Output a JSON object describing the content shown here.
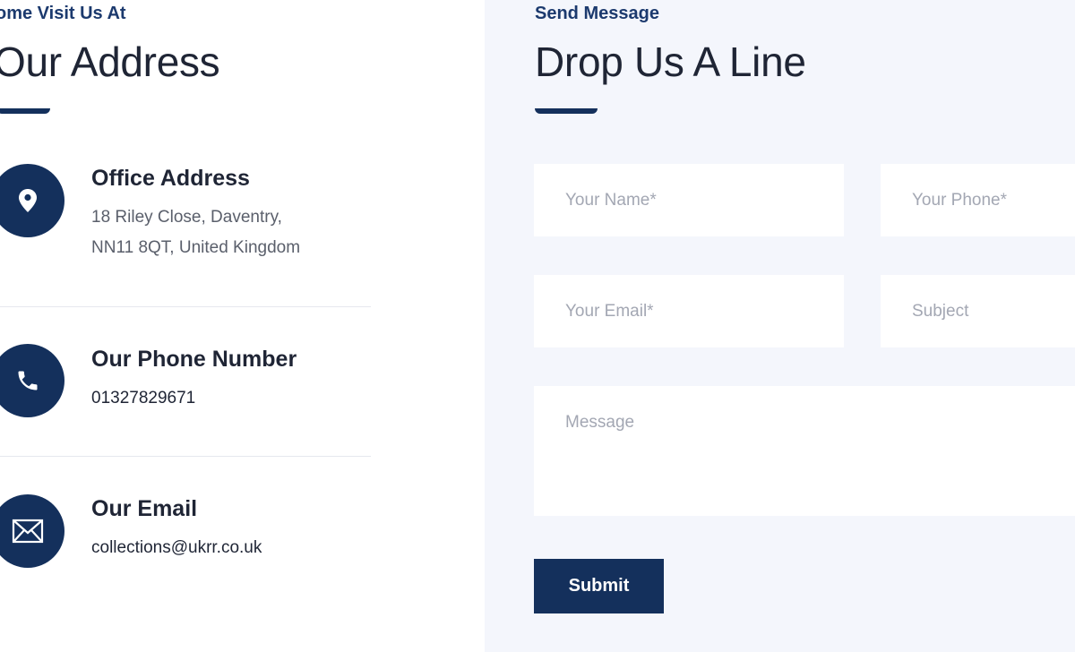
{
  "contact_info": {
    "eyebrow": "ome Visit Us At",
    "title": "Our Address",
    "items": [
      {
        "icon": "map-pin-icon",
        "title": "Office Address",
        "lines": [
          "18 Riley Close, Daventry,",
          "NN11 8QT, United Kingdom"
        ]
      },
      {
        "icon": "phone-icon",
        "title": "Our Phone Number",
        "lines": [
          "01327829671"
        ]
      },
      {
        "icon": "envelope-icon",
        "title": "Our Email",
        "lines": [
          "collections@ukrr.co.uk"
        ]
      }
    ]
  },
  "contact_form": {
    "eyebrow": "Send Message",
    "title": "Drop Us A Line",
    "fields": {
      "name": {
        "placeholder": "Your Name*",
        "value": ""
      },
      "phone": {
        "placeholder": "Your Phone*",
        "value": ""
      },
      "email": {
        "placeholder": "Your Email*",
        "value": ""
      },
      "subject": {
        "placeholder": "Subject",
        "value": ""
      },
      "message": {
        "placeholder": "Message",
        "value": ""
      }
    },
    "submit_label": "Submit"
  },
  "colors": {
    "brand_navy": "#14305c",
    "eyebrow_blue": "#1c3a6e",
    "heading_text": "#1f2535",
    "form_panel_bg": "#f4f6fc"
  }
}
